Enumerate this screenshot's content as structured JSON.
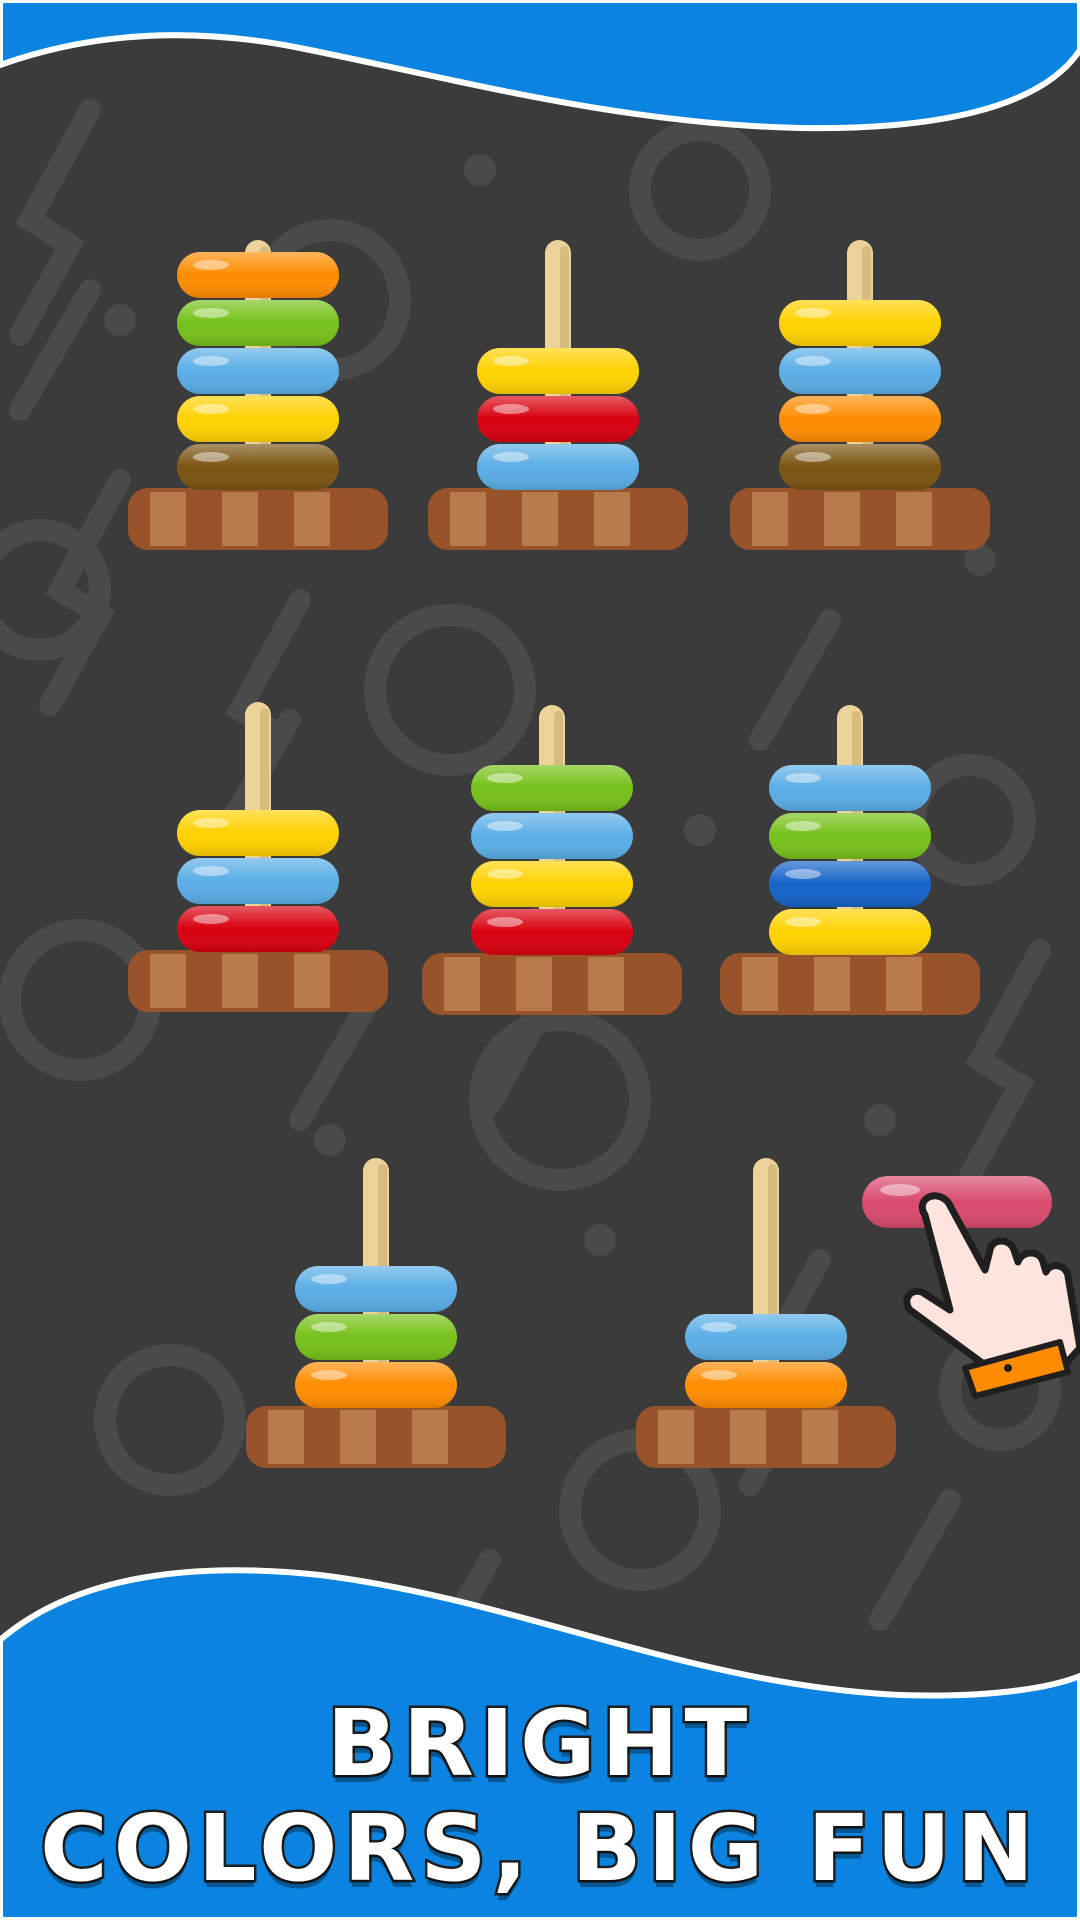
{
  "caption": {
    "line1": "BRIGHT",
    "line2": "COLORS, BIG FUN"
  },
  "colors": {
    "background": "#3b3b3b",
    "pattern": "#4a4a4a",
    "banner": "#0a84e0",
    "wave_border": "#ffffff",
    "peg": "#ecd39a",
    "peg_shade": "#d8bc7e",
    "base_dark": "#98532a",
    "base_light": "#b77a4b",
    "rings": {
      "orange": "#ff8c00",
      "green": "#76c11a",
      "light-blue": "#5aaee6",
      "yellow": "#ffd200",
      "brown": "#7a5412",
      "red": "#d9000f",
      "blue": "#1463c8",
      "pink": "#d94a6e"
    }
  },
  "towers": [
    {
      "name": "tower-1",
      "rings_bottom_to_top": [
        "brown",
        "yellow",
        "light-blue",
        "green",
        "orange"
      ]
    },
    {
      "name": "tower-2",
      "rings_bottom_to_top": [
        "light-blue",
        "red",
        "yellow"
      ]
    },
    {
      "name": "tower-3",
      "rings_bottom_to_top": [
        "brown",
        "orange",
        "light-blue",
        "yellow"
      ]
    },
    {
      "name": "tower-4",
      "rings_bottom_to_top": [
        "red",
        "light-blue",
        "yellow"
      ]
    },
    {
      "name": "tower-5",
      "rings_bottom_to_top": [
        "red",
        "yellow",
        "light-blue",
        "green"
      ]
    },
    {
      "name": "tower-6",
      "rings_bottom_to_top": [
        "yellow",
        "blue",
        "green",
        "light-blue"
      ]
    },
    {
      "name": "tower-7",
      "rings_bottom_to_top": [
        "orange",
        "green",
        "light-blue"
      ]
    },
    {
      "name": "tower-8",
      "rings_bottom_to_top": [
        "orange",
        "light-blue"
      ]
    }
  ],
  "held_ring": {
    "color": "pink"
  },
  "icons": {
    "hand": "pointing-hand-icon"
  }
}
